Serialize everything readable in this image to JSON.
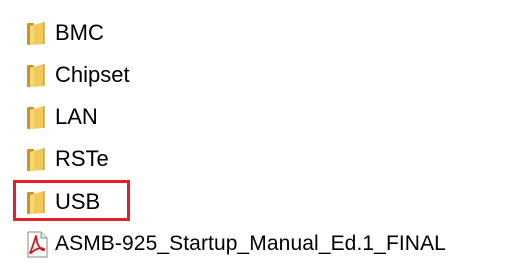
{
  "explorer": {
    "items": [
      {
        "label": "BMC",
        "type": "folder",
        "icon": "folder-icon"
      },
      {
        "label": "Chipset",
        "type": "folder",
        "icon": "folder-icon"
      },
      {
        "label": "LAN",
        "type": "folder",
        "icon": "folder-icon"
      },
      {
        "label": "RSTe",
        "type": "folder",
        "icon": "folder-icon"
      },
      {
        "label": "USB",
        "type": "folder",
        "icon": "folder-icon",
        "highlighted": true
      },
      {
        "label": "ASMB-925_Startup_Manual_Ed.1_FINAL",
        "type": "pdf",
        "icon": "pdf-icon"
      }
    ]
  },
  "colors": {
    "highlight": "#e5202c",
    "folder_light": "#f7d774",
    "folder_dark": "#c9971f",
    "pdf_red": "#d2191e"
  }
}
